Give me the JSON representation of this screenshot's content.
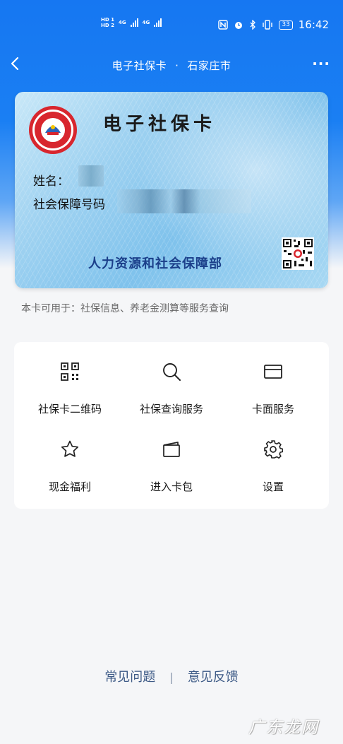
{
  "status_bar": {
    "hd1": "HD 1",
    "hd2": "HD 2",
    "net1": "4G",
    "net2": "4G",
    "battery": "33",
    "time": "16:42",
    "icons": [
      "nfc-icon",
      "alarm-icon",
      "bluetooth-icon",
      "vibrate-icon"
    ]
  },
  "nav": {
    "title": "电子社保卡",
    "separator": "·",
    "city": "石家庄市",
    "more": "···"
  },
  "card": {
    "seal_top_text": "SOCIAL SECURITY CARD",
    "seal_bottom_text": "社会保障卡",
    "title": "电子社保卡",
    "name_label": "姓名：",
    "id_label": "社会保障号码",
    "issuer": "人力资源和社会保障部"
  },
  "usage_note": "本卡可用于：社保信息、养老金测算等服务查询",
  "services": [
    {
      "label": "社保卡二维码",
      "icon": "qrcode-icon"
    },
    {
      "label": "社保查询服务",
      "icon": "search-icon"
    },
    {
      "label": "卡面服务",
      "icon": "card-icon"
    },
    {
      "label": "现金福利",
      "icon": "star-icon"
    },
    {
      "label": "进入卡包",
      "icon": "wallet-icon"
    },
    {
      "label": "设置",
      "icon": "gear-icon"
    }
  ],
  "footer": {
    "faq": "常见问题",
    "separator": "|",
    "feedback": "意见反馈"
  },
  "watermark": "广东龙网",
  "colors": {
    "primary_blue": "#1677f2",
    "issuer_text": "#1b3f8a",
    "footer_link": "#3d5a86",
    "seal_red": "#d8262e"
  }
}
